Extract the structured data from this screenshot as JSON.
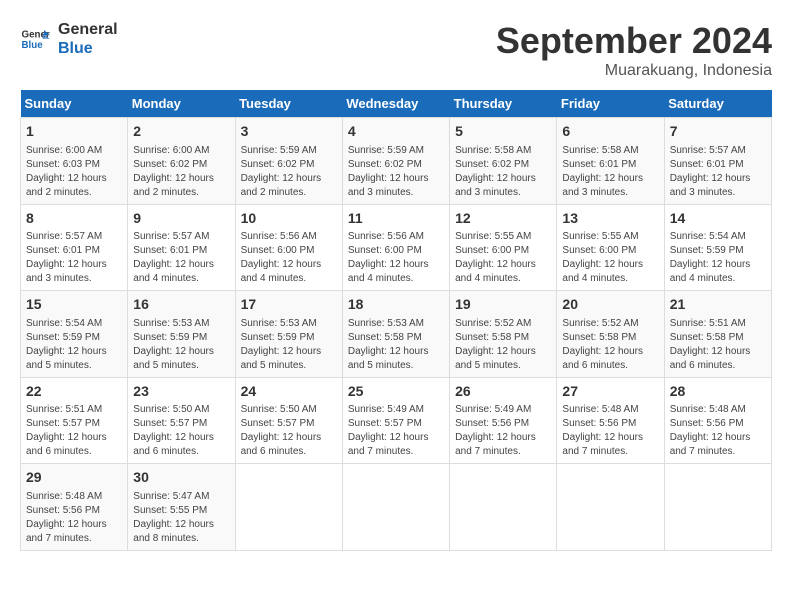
{
  "header": {
    "logo_line1": "General",
    "logo_line2": "Blue",
    "month": "September 2024",
    "location": "Muarakuang, Indonesia"
  },
  "days_of_week": [
    "Sunday",
    "Monday",
    "Tuesday",
    "Wednesday",
    "Thursday",
    "Friday",
    "Saturday"
  ],
  "weeks": [
    [
      {
        "day": "1",
        "info": "Sunrise: 6:00 AM\nSunset: 6:03 PM\nDaylight: 12 hours\nand 2 minutes."
      },
      {
        "day": "2",
        "info": "Sunrise: 6:00 AM\nSunset: 6:02 PM\nDaylight: 12 hours\nand 2 minutes."
      },
      {
        "day": "3",
        "info": "Sunrise: 5:59 AM\nSunset: 6:02 PM\nDaylight: 12 hours\nand 2 minutes."
      },
      {
        "day": "4",
        "info": "Sunrise: 5:59 AM\nSunset: 6:02 PM\nDaylight: 12 hours\nand 3 minutes."
      },
      {
        "day": "5",
        "info": "Sunrise: 5:58 AM\nSunset: 6:02 PM\nDaylight: 12 hours\nand 3 minutes."
      },
      {
        "day": "6",
        "info": "Sunrise: 5:58 AM\nSunset: 6:01 PM\nDaylight: 12 hours\nand 3 minutes."
      },
      {
        "day": "7",
        "info": "Sunrise: 5:57 AM\nSunset: 6:01 PM\nDaylight: 12 hours\nand 3 minutes."
      }
    ],
    [
      {
        "day": "8",
        "info": "Sunrise: 5:57 AM\nSunset: 6:01 PM\nDaylight: 12 hours\nand 3 minutes."
      },
      {
        "day": "9",
        "info": "Sunrise: 5:57 AM\nSunset: 6:01 PM\nDaylight: 12 hours\nand 4 minutes."
      },
      {
        "day": "10",
        "info": "Sunrise: 5:56 AM\nSunset: 6:00 PM\nDaylight: 12 hours\nand 4 minutes."
      },
      {
        "day": "11",
        "info": "Sunrise: 5:56 AM\nSunset: 6:00 PM\nDaylight: 12 hours\nand 4 minutes."
      },
      {
        "day": "12",
        "info": "Sunrise: 5:55 AM\nSunset: 6:00 PM\nDaylight: 12 hours\nand 4 minutes."
      },
      {
        "day": "13",
        "info": "Sunrise: 5:55 AM\nSunset: 6:00 PM\nDaylight: 12 hours\nand 4 minutes."
      },
      {
        "day": "14",
        "info": "Sunrise: 5:54 AM\nSunset: 5:59 PM\nDaylight: 12 hours\nand 4 minutes."
      }
    ],
    [
      {
        "day": "15",
        "info": "Sunrise: 5:54 AM\nSunset: 5:59 PM\nDaylight: 12 hours\nand 5 minutes."
      },
      {
        "day": "16",
        "info": "Sunrise: 5:53 AM\nSunset: 5:59 PM\nDaylight: 12 hours\nand 5 minutes."
      },
      {
        "day": "17",
        "info": "Sunrise: 5:53 AM\nSunset: 5:59 PM\nDaylight: 12 hours\nand 5 minutes."
      },
      {
        "day": "18",
        "info": "Sunrise: 5:53 AM\nSunset: 5:58 PM\nDaylight: 12 hours\nand 5 minutes."
      },
      {
        "day": "19",
        "info": "Sunrise: 5:52 AM\nSunset: 5:58 PM\nDaylight: 12 hours\nand 5 minutes."
      },
      {
        "day": "20",
        "info": "Sunrise: 5:52 AM\nSunset: 5:58 PM\nDaylight: 12 hours\nand 6 minutes."
      },
      {
        "day": "21",
        "info": "Sunrise: 5:51 AM\nSunset: 5:58 PM\nDaylight: 12 hours\nand 6 minutes."
      }
    ],
    [
      {
        "day": "22",
        "info": "Sunrise: 5:51 AM\nSunset: 5:57 PM\nDaylight: 12 hours\nand 6 minutes."
      },
      {
        "day": "23",
        "info": "Sunrise: 5:50 AM\nSunset: 5:57 PM\nDaylight: 12 hours\nand 6 minutes."
      },
      {
        "day": "24",
        "info": "Sunrise: 5:50 AM\nSunset: 5:57 PM\nDaylight: 12 hours\nand 6 minutes."
      },
      {
        "day": "25",
        "info": "Sunrise: 5:49 AM\nSunset: 5:57 PM\nDaylight: 12 hours\nand 7 minutes."
      },
      {
        "day": "26",
        "info": "Sunrise: 5:49 AM\nSunset: 5:56 PM\nDaylight: 12 hours\nand 7 minutes."
      },
      {
        "day": "27",
        "info": "Sunrise: 5:48 AM\nSunset: 5:56 PM\nDaylight: 12 hours\nand 7 minutes."
      },
      {
        "day": "28",
        "info": "Sunrise: 5:48 AM\nSunset: 5:56 PM\nDaylight: 12 hours\nand 7 minutes."
      }
    ],
    [
      {
        "day": "29",
        "info": "Sunrise: 5:48 AM\nSunset: 5:56 PM\nDaylight: 12 hours\nand 7 minutes."
      },
      {
        "day": "30",
        "info": "Sunrise: 5:47 AM\nSunset: 5:55 PM\nDaylight: 12 hours\nand 8 minutes."
      },
      {
        "day": "",
        "info": ""
      },
      {
        "day": "",
        "info": ""
      },
      {
        "day": "",
        "info": ""
      },
      {
        "day": "",
        "info": ""
      },
      {
        "day": "",
        "info": ""
      }
    ]
  ]
}
